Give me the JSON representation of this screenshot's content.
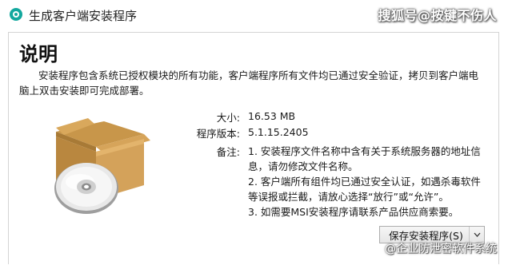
{
  "window": {
    "title": "生成客户端安装程序",
    "icon": "app-logo-icon",
    "accent": "#13a89e"
  },
  "watermarks": {
    "top": "搜狐号@按键不伤人",
    "bottom": "@企业防泄密软件系统"
  },
  "content": {
    "heading": "说明",
    "description": "安装程序包含系统已授权模块的所有功能，客户端程序所有文件均已通过安全验证，拷贝到客户端电脑上双击安装即可完成部署。",
    "size_label": "大小:",
    "size_value": "16.53 MB",
    "version_label": "程序版本:",
    "version_value": "5.1.15.2405",
    "notes_label": "备注:",
    "notes": [
      "1. 安装程序文件名称中含有关于系统服务器的地址信息，请勿修改文件名称。",
      "2. 客户端所有组件均已通过安全认证，如遇杀毒软件等误报或拦截，请放心选择“放行”或“允许”。",
      "3. 如需要MSI安装程序请联系产品供应商索要。"
    ]
  },
  "actions": {
    "save_label": "保存安装程序(S)",
    "dropdown_icon": "chevron-down-icon"
  }
}
